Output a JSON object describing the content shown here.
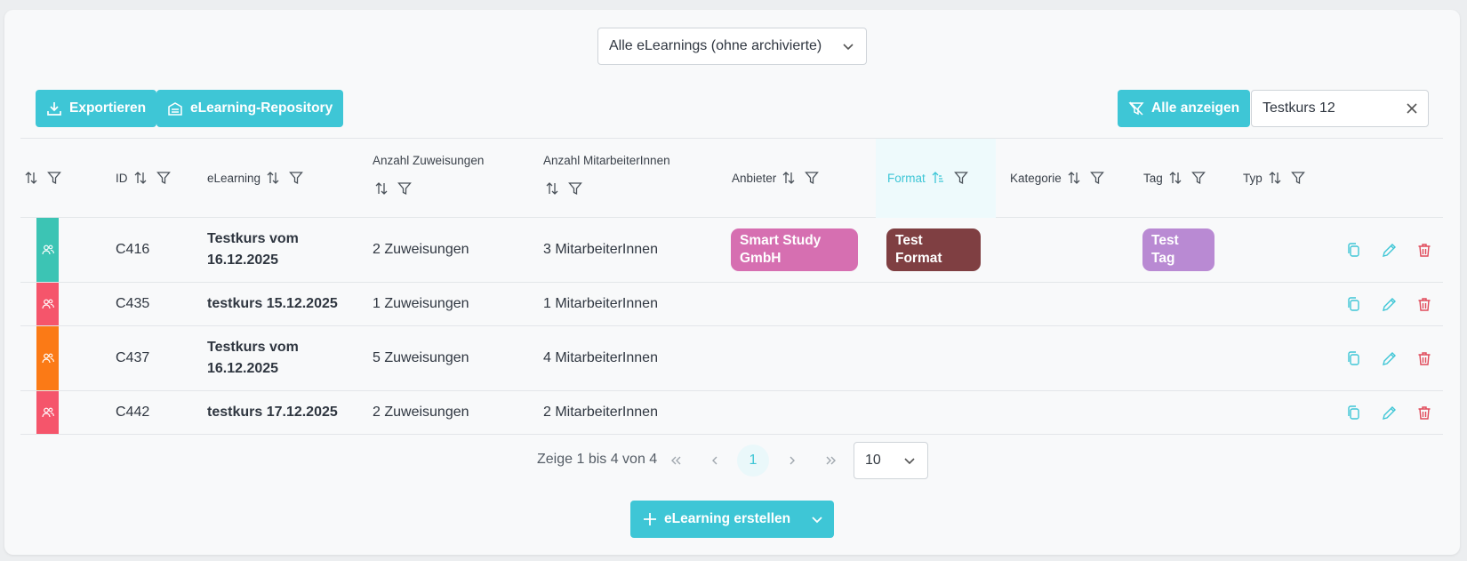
{
  "filter_select": {
    "value": "Alle eLearnings (ohne archivierte)"
  },
  "toolbar": {
    "export_label": "Exportieren",
    "repository_label": "eLearning-Repository",
    "show_all_label": "Alle anzeigen",
    "search_value": "Testkurs 12"
  },
  "columns": {
    "id": "ID",
    "elearning": "eLearning",
    "assignments": "Anzahl Zuweisungen",
    "employees": "Anzahl MitarbeiterInnen",
    "provider": "Anbieter",
    "format": "Format",
    "category": "Kategorie",
    "tag": "Tag",
    "type": "Typ"
  },
  "rows": [
    {
      "id": "C416",
      "name_line1": "Testkurs vom",
      "name_line2": "16.12.2025",
      "assignments": "2 Zuweisungen",
      "employees": "3 MitarbeiterInnen",
      "provider_line1": "Smart Study",
      "provider_line2": "GmbH",
      "format_line1": "Test",
      "format_line2": "Format",
      "tag_line1": "Test",
      "tag_line2": "Tag",
      "status_color": "#3cc4b4"
    },
    {
      "id": "C435",
      "name_line1": "testkurs 15.12.2025",
      "assignments": "1 Zuweisungen",
      "employees": "1 MitarbeiterInnen",
      "status_color": "#f5556b"
    },
    {
      "id": "C437",
      "name_line1": "Testkurs vom",
      "name_line2": "16.12.2025",
      "assignments": "5 Zuweisungen",
      "employees": "4 MitarbeiterInnen",
      "status_color": "#fb7a16"
    },
    {
      "id": "C442",
      "name_line1": "testkurs 17.12.2025",
      "assignments": "2 Zuweisungen",
      "employees": "2 MitarbeiterInnen",
      "status_color": "#f5556b"
    }
  ],
  "colors": {
    "accent": "#3ec6d6",
    "provider_badge": "#d66fb1",
    "format_badge": "#7f3f42",
    "tag_badge": "#b98ad3",
    "delete": "#e04a5a"
  },
  "pagination": {
    "summary": "Zeige 1 bis 4 von 4",
    "current_page": "1",
    "page_size": "10"
  },
  "create": {
    "label": "eLearning erstellen"
  }
}
